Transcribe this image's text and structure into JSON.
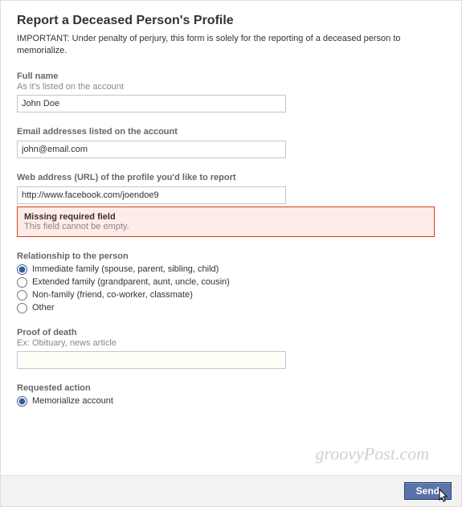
{
  "title": "Report a Deceased Person's Profile",
  "important": "IMPORTANT: Under penalty of perjury, this form is solely for the reporting of a deceased person to memorialize.",
  "fullName": {
    "label": "Full name",
    "hint": "As it's listed on the account",
    "value": "John Doe"
  },
  "email": {
    "label": "Email addresses listed on the account",
    "value": "john@email.com"
  },
  "url": {
    "label": "Web address (URL) of the profile you'd like to report",
    "value": "http://www.facebook.com/joendoe9"
  },
  "error": {
    "title": "Missing required field",
    "message": "This field cannot be empty."
  },
  "relationship": {
    "label": "Relationship to the person",
    "options": [
      "Immediate family (spouse, parent, sibling, child)",
      "Extended family (grandparent, aunt, uncle, cousin)",
      "Non-family (friend, co-worker, classmate)",
      "Other"
    ],
    "selectedIndex": 0
  },
  "proof": {
    "label": "Proof of death",
    "hint": "Ex: Obituary, news article",
    "value": ""
  },
  "requestedAction": {
    "label": "Requested action",
    "options": [
      "Memorialize account"
    ],
    "selectedIndex": 0
  },
  "buttons": {
    "send": "Send"
  },
  "watermark": "groovyPost.com"
}
